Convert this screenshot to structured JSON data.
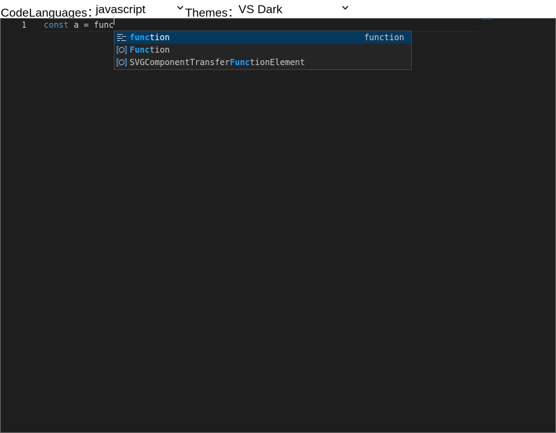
{
  "toolbar": {
    "languages_label": "CodeLanguages：",
    "language_value": "javascript",
    "themes_label": "Themes：",
    "theme_value": "VS Dark"
  },
  "editor": {
    "line_number": "1",
    "code": {
      "keyword": "const",
      "rest": " a = func"
    }
  },
  "suggestions": {
    "items": [
      {
        "icon": "keyword-snippet-icon",
        "prefix": "",
        "match": "func",
        "suffix": "tion",
        "detail": "function"
      },
      {
        "icon": "variable-icon",
        "prefix": "",
        "match": "Func",
        "suffix": "tion",
        "detail": ""
      },
      {
        "icon": "variable-icon",
        "prefix": "SVGComponentTransfer",
        "match": "Func",
        "suffix": "tionElement",
        "detail": ""
      }
    ]
  },
  "colors": {
    "editor_bg": "#1e1e1e",
    "keyword": "#569cd6",
    "match_highlight": "#18a3ff",
    "selected_bg": "#04395e",
    "widget_bg": "#252526"
  }
}
